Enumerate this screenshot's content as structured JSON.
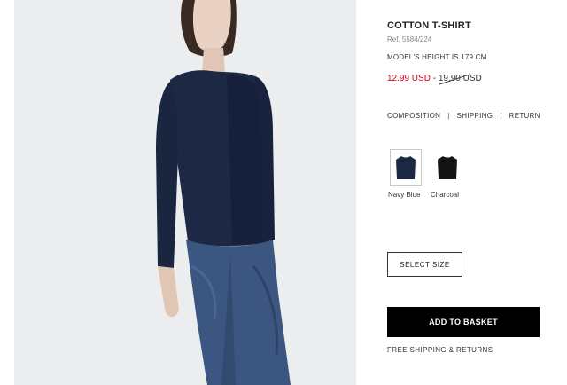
{
  "product": {
    "title": "COTTON T-SHIRT",
    "ref": "Ref. 5584/224",
    "model_height": "MODEL'S HEIGHT IS 179 CM",
    "price_sale": "12.99 USD",
    "price_separator": "-",
    "price_original": "19.90 USD"
  },
  "info_links": [
    {
      "label": "COMPOSITION"
    },
    {
      "label": "SHIPPING"
    },
    {
      "label": "RETURN"
    }
  ],
  "colors": [
    {
      "name": "Navy Blue",
      "hex": "#1c2844",
      "selected": true
    },
    {
      "name": "Charcoal",
      "hex": "#141414",
      "selected": false
    }
  ],
  "buttons": {
    "select_size": "SELECT SIZE",
    "add_to_basket": "ADD TO BASKET"
  },
  "shipping_note": "FREE SHIPPING & RETURNS",
  "theme": {
    "sale_color": "#d0021b",
    "button_dark": "#000000",
    "photo_bg": "#ecedef"
  }
}
